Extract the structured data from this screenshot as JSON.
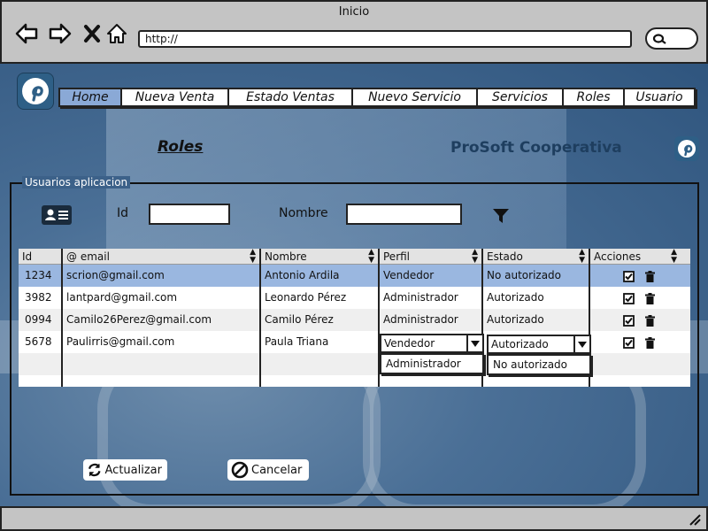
{
  "window": {
    "title": "Inicio"
  },
  "browser": {
    "url": "http://"
  },
  "nav": {
    "items": [
      "Home",
      "Nueva Venta",
      "Estado Ventas",
      "Nuevo Servicio",
      "Servicios",
      "Roles",
      "Usuario"
    ]
  },
  "page": {
    "title": "Roles",
    "brand": "ProSoft Cooperativa"
  },
  "panel": {
    "legend": "Usuarios aplicacion"
  },
  "filters": {
    "id_label": "Id",
    "id_value": "",
    "name_label": "Nombre",
    "name_value": ""
  },
  "table": {
    "headers": [
      "Id",
      "@ email",
      "Nombre",
      "Perfil",
      "Estado",
      "Acciones"
    ],
    "rows": [
      {
        "id": "1234",
        "email": "scrion@gmail.com",
        "nombre": "Antonio Ardila",
        "perfil": "Vendedor",
        "estado": "No autorizado"
      },
      {
        "id": "3982",
        "email": "lantpard@gmail.com",
        "nombre": "Leonardo Pérez",
        "perfil": "Administrador",
        "estado": "Autorizado"
      },
      {
        "id": "0994",
        "email": "Camilo26Perez@gmail.com",
        "nombre": "Camilo Pérez",
        "perfil": "Administrador",
        "estado": "Autorizado"
      },
      {
        "id": "5678",
        "email": "Paulirris@gmail.com",
        "nombre": "Paula Triana",
        "perfil": "Vendedor",
        "estado": "Autorizado"
      }
    ],
    "perfil_dropdown_option": "Administrador",
    "estado_dropdown_option": "No autorizado"
  },
  "buttons": {
    "update": "Actualizar",
    "cancel": "Cancelar"
  },
  "colors": {
    "selected_row": "#9ab7e0",
    "menu_active": "#8aa9d6",
    "brand_text": "#1e3e5f"
  }
}
